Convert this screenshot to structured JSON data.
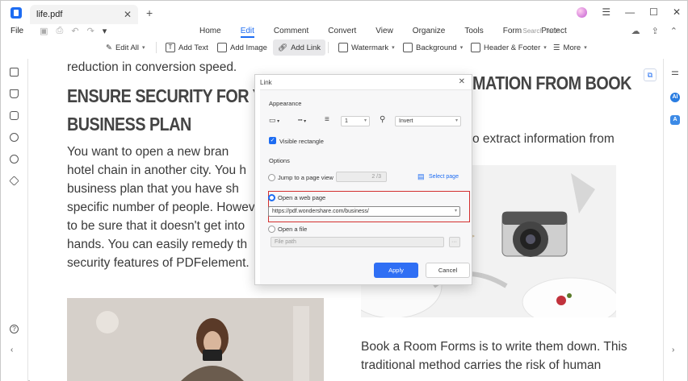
{
  "window": {
    "tab_title": "life.pdf"
  },
  "menu": {
    "file": "File",
    "items": [
      "Home",
      "Edit",
      "Comment",
      "Convert",
      "View",
      "Organize",
      "Tools",
      "Form",
      "Protect"
    ],
    "active": "Edit",
    "search_placeholder": "Search Tools"
  },
  "toolbar": {
    "edit_all": "Edit All",
    "add_text": "Add Text",
    "add_image": "Add Image",
    "add_link": "Add Link",
    "watermark": "Watermark",
    "background": "Background",
    "header_footer": "Header & Footer",
    "more": "More"
  },
  "document": {
    "line_top": "reduction in conversion speed.",
    "heading_left_1": "ENSURE SECURITY FOR YO",
    "heading_left_2": "BUSINESS PLAN",
    "heading_right": "MATION FROM BOOK",
    "right_line": "o extract information from",
    "left_body": [
      "You want to open a new bran",
      "hotel chain in another city. You h",
      "business plan that you have sh",
      "specific number of people. Howev",
      "to be sure that it doesn't get into",
      "hands. You can easily remedy th",
      "security features of PDFelement."
    ],
    "right_body": [
      "Book a Room Forms is to write them down. This",
      "traditional method carries the risk of human"
    ]
  },
  "dialog": {
    "title": "Link",
    "appearance_label": "Appearance",
    "line_width_value": "1",
    "highlight_value": "Invert",
    "visible_rectangle": "Visible rectangle",
    "visible_rectangle_checked": true,
    "options_label": "Options",
    "jump_label": "Jump to a page view",
    "page_value": "2 /3",
    "select_page": "Select page",
    "web_label": "Open a web page",
    "url_value": "https://pdf.wondershare.com/business/",
    "file_label": "Open a file",
    "file_placeholder": "File path",
    "browse": "···",
    "apply": "Apply",
    "cancel": "Cancel",
    "selected_option": "web"
  },
  "colors": {
    "accent": "#1d6cf2",
    "highlight": "#d32f2f"
  }
}
